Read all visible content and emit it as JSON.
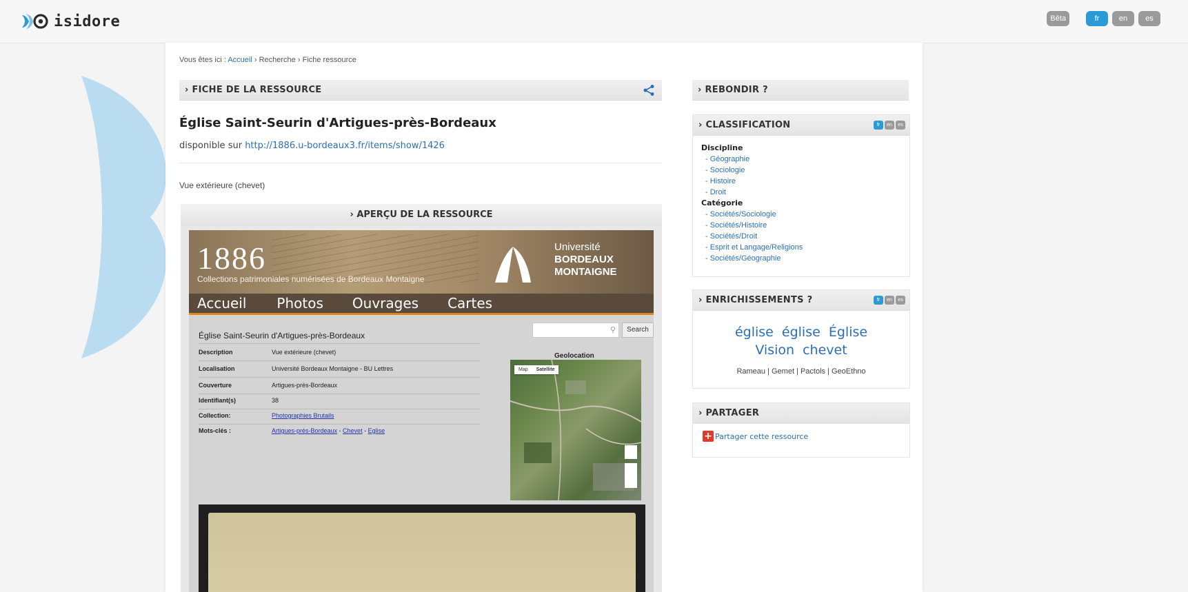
{
  "header": {
    "app_name": "isidore",
    "beta": "Bêta",
    "languages": [
      "fr",
      "en",
      "es"
    ],
    "active_language": "fr"
  },
  "breadcrumb": {
    "prefix": "Vous êtes ici :",
    "items": [
      "Accueil",
      "Recherche",
      "Fiche ressource"
    ],
    "separator": "›"
  },
  "resource": {
    "section_title": "› FICHE DE LA RESSOURCE",
    "title": "Église Saint-Seurin d'Artigues-près-Bordeaux",
    "available_prefix": "disponible sur",
    "available_url": "http://1886.u-bordeaux3.fr/items/show/1426",
    "description": "Vue extérieure (chevet)",
    "preview_title": "› APERÇU DE LA RESSOURCE"
  },
  "embedded": {
    "banner_number": "1886",
    "banner_subtitle": "Collections patrimoniales numérisées de Bordeaux Montaigne",
    "university_line1": "Université",
    "university_line2": "BORDEAUX",
    "university_line3": "MONTAIGNE",
    "nav": [
      "Accueil",
      "Photos",
      "Ouvrages",
      "Cartes"
    ],
    "search_button": "Search",
    "item_title": "Église Saint-Seurin d'Artigues-près-Bordeaux",
    "rows": [
      {
        "key": "Description",
        "value": "Vue extérieure (chevet)"
      },
      {
        "key": "Localisation",
        "value": "Université Bordeaux Montaigne - BU Lettres"
      },
      {
        "key": "Couverture",
        "value": "Artigues-près-Bordeaux"
      },
      {
        "key": "Identifiant(s)",
        "value": "38"
      },
      {
        "key": "Collection:",
        "value": "Photographies Brutails"
      },
      {
        "key": "Mots-clés :",
        "value": "Artigues-près-Bordeaux - Chevet - Eglise"
      }
    ],
    "keywords": [
      "Artigues-près-Bordeaux",
      "Chevet",
      "Eglise"
    ],
    "geolocation_label": "Geolocation",
    "map_tabs": [
      "Map",
      "Satellite"
    ]
  },
  "sidebar": {
    "rebondir_title": "› REBONDIR ?",
    "classification_title": "› CLASSIFICATION",
    "discipline_label": "Discipline",
    "disciplines": [
      "- Géographie",
      "- Sociologie",
      "- Histoire",
      "- Droit"
    ],
    "categorie_label": "Catégorie",
    "categories": [
      "- Sociétés/Sociologie",
      "- Sociétés/Histoire",
      "- Sociétés/Droit",
      "- Esprit et Langage/Religions",
      "- Sociétés/Géographie"
    ],
    "enrich_title": "› ENRICHISSEMENTS ?",
    "cloud_line1": [
      "église",
      "église",
      "Église"
    ],
    "cloud_line2": [
      "Vision",
      "chevet"
    ],
    "vocabularies": "Rameau | Gemet | Pactols | GeoEthno",
    "partager_title": "› PARTAGER",
    "share_label": "Partager cette ressource"
  },
  "colors": {
    "accent": "#2a9bd6",
    "link": "#2a6fb5",
    "petal": "#b9dcf0"
  }
}
